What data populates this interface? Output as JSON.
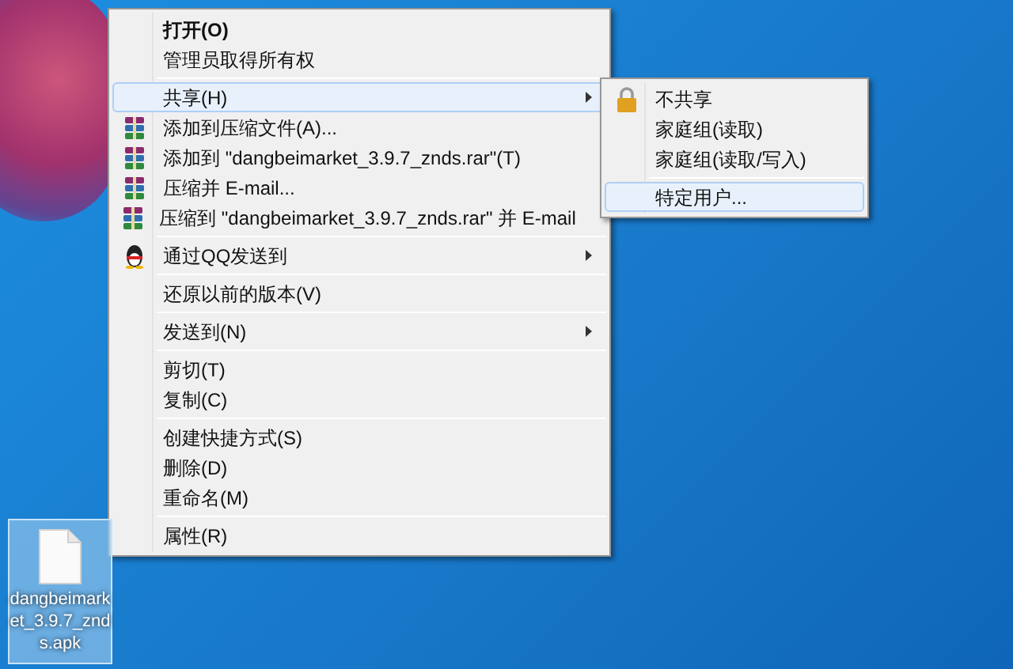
{
  "desktop_icon": {
    "label": "dangbeimarket_3.9.7_znds.apk",
    "selected": true
  },
  "context_menu": {
    "items": [
      {
        "kind": "item",
        "label": "打开(O)",
        "bold": true,
        "submenu": false,
        "selected": false
      },
      {
        "kind": "item",
        "label": "管理员取得所有权",
        "bold": false,
        "submenu": false,
        "selected": false
      },
      {
        "kind": "separator"
      },
      {
        "kind": "item",
        "label": "共享(H)",
        "bold": false,
        "submenu": true,
        "selected": true
      },
      {
        "kind": "archive",
        "label": "添加到压缩文件(A)...",
        "bold": false,
        "submenu": false,
        "selected": false
      },
      {
        "kind": "archive",
        "label": "添加到 \"dangbeimarket_3.9.7_znds.rar\"(T)",
        "bold": false,
        "submenu": false,
        "selected": false
      },
      {
        "kind": "archive",
        "label": "压缩并 E-mail...",
        "bold": false,
        "submenu": false,
        "selected": false
      },
      {
        "kind": "archive",
        "label": "压缩到 \"dangbeimarket_3.9.7_znds.rar\" 并 E-mail",
        "bold": false,
        "submenu": false,
        "selected": false
      },
      {
        "kind": "separator"
      },
      {
        "kind": "qq",
        "label": "通过QQ发送到",
        "bold": false,
        "submenu": true,
        "selected": false
      },
      {
        "kind": "separator"
      },
      {
        "kind": "item",
        "label": "还原以前的版本(V)",
        "bold": false,
        "submenu": false,
        "selected": false
      },
      {
        "kind": "separator"
      },
      {
        "kind": "item",
        "label": "发送到(N)",
        "bold": false,
        "submenu": true,
        "selected": false
      },
      {
        "kind": "separator"
      },
      {
        "kind": "item",
        "label": "剪切(T)",
        "bold": false,
        "submenu": false,
        "selected": false
      },
      {
        "kind": "item",
        "label": "复制(C)",
        "bold": false,
        "submenu": false,
        "selected": false
      },
      {
        "kind": "separator"
      },
      {
        "kind": "item",
        "label": "创建快捷方式(S)",
        "bold": false,
        "submenu": false,
        "selected": false
      },
      {
        "kind": "item",
        "label": "删除(D)",
        "bold": false,
        "submenu": false,
        "selected": false
      },
      {
        "kind": "item",
        "label": "重命名(M)",
        "bold": false,
        "submenu": false,
        "selected": false
      },
      {
        "kind": "separator"
      },
      {
        "kind": "item",
        "label": "属性(R)",
        "bold": false,
        "submenu": false,
        "selected": false
      }
    ]
  },
  "submenu": {
    "items": [
      {
        "kind": "lock",
        "label": "不共享",
        "selected": false
      },
      {
        "kind": "item",
        "label": "家庭组(读取)",
        "selected": false
      },
      {
        "kind": "item",
        "label": "家庭组(读取/写入)",
        "selected": false
      },
      {
        "kind": "separator"
      },
      {
        "kind": "item",
        "label": "特定用户...",
        "selected": true
      }
    ]
  }
}
